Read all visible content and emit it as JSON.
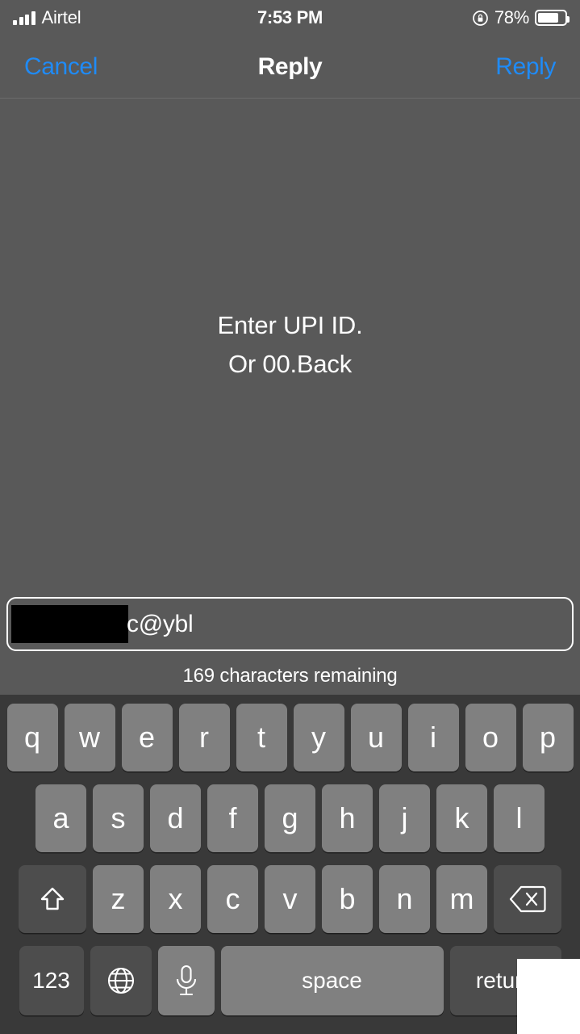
{
  "status_bar": {
    "carrier": "Airtel",
    "time": "7:53 PM",
    "battery_percent": "78%",
    "battery_level": 78,
    "signal_bars": 4,
    "rotation_lock_icon": "rotation-lock-icon",
    "battery_icon": "battery-icon"
  },
  "nav_bar": {
    "cancel_label": "Cancel",
    "title": "Reply",
    "reply_label": "Reply",
    "accent_color": "#1f8bf7"
  },
  "message": {
    "line1": "Enter UPI ID.",
    "line2": "Or 00.Back"
  },
  "input": {
    "redacted": true,
    "visible_value": "c@ybl",
    "char_counter": "169 characters remaining"
  },
  "keyboard": {
    "row1": [
      "q",
      "w",
      "e",
      "r",
      "t",
      "y",
      "u",
      "i",
      "o",
      "p"
    ],
    "row2": [
      "a",
      "s",
      "d",
      "f",
      "g",
      "h",
      "j",
      "k",
      "l"
    ],
    "row3_letters": [
      "z",
      "x",
      "c",
      "v",
      "b",
      "n",
      "m"
    ],
    "shift_icon": "shift-arrow-icon",
    "backspace_icon": "backspace-icon",
    "numeric_label": "123",
    "globe_icon": "globe-icon",
    "mic_icon": "microphone-icon",
    "space_label": "space",
    "return_label": "return",
    "key_color": "#808080",
    "function_key_color": "#4d4d4d",
    "background_color": "#393939"
  },
  "colors": {
    "screen_background": "#595959",
    "text": "#ffffff"
  }
}
